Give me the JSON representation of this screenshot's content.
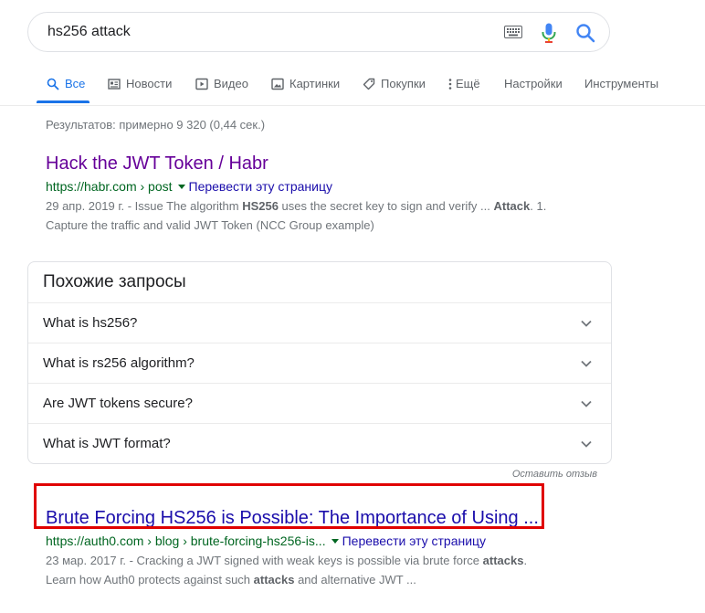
{
  "search": {
    "query": "hs256 attack"
  },
  "tabs": [
    {
      "label": "Все",
      "icon": "search-icon"
    },
    {
      "label": "Новости",
      "icon": "news-icon"
    },
    {
      "label": "Видео",
      "icon": "video-icon"
    },
    {
      "label": "Картинки",
      "icon": "image-icon"
    },
    {
      "label": "Покупки",
      "icon": "tag-icon"
    },
    {
      "label": "Ещё",
      "icon": "more-vert-icon"
    },
    {
      "label": "Настройки"
    },
    {
      "label": "Инструменты"
    }
  ],
  "stats": "Результатов: примерно 9 320 (0,44 сек.)",
  "result1": {
    "title": "Hack the JWT Token / Habr",
    "url": "https://habr.com › post",
    "translate": "Перевести эту страницу",
    "snippet_line1_a": "29 апр. 2019 г. - Issue The algorithm ",
    "snippet_line1_b": "HS256",
    "snippet_line1_c": " uses the secret key to sign and verify ... ",
    "snippet_line1_d": "Attack",
    "snippet_line1_e": ". 1.",
    "snippet_line2": "Capture the traffic and valid JWT Token (NCC Group example)"
  },
  "related": {
    "title": "Похожие запросы",
    "questions": [
      "What is hs256?",
      "What is rs256 algorithm?",
      "Are JWT tokens secure?",
      "What is JWT format?"
    ]
  },
  "feedback": "Оставить отзыв",
  "result2": {
    "title": "Brute Forcing HS256 is Possible: The Importance of Using ...",
    "url": "https://auth0.com › blog › brute-forcing-hs256-is...",
    "translate": "Перевести эту страницу",
    "snippet_line1_a": "23 мар. 2017 г. - Cracking a JWT signed with weak keys is possible via brute force ",
    "snippet_line1_b": "attacks",
    "snippet_line1_c": ".",
    "snippet_line2_a": "Learn how Auth0 protects against such ",
    "snippet_line2_b": "attacks",
    "snippet_line2_c": " and alternative JWT ..."
  },
  "colors": {
    "accent": "#1a73e8",
    "visited_link": "#660099",
    "link": "#1a0dab",
    "url_green": "#006621",
    "highlight_red": "#e00000"
  }
}
